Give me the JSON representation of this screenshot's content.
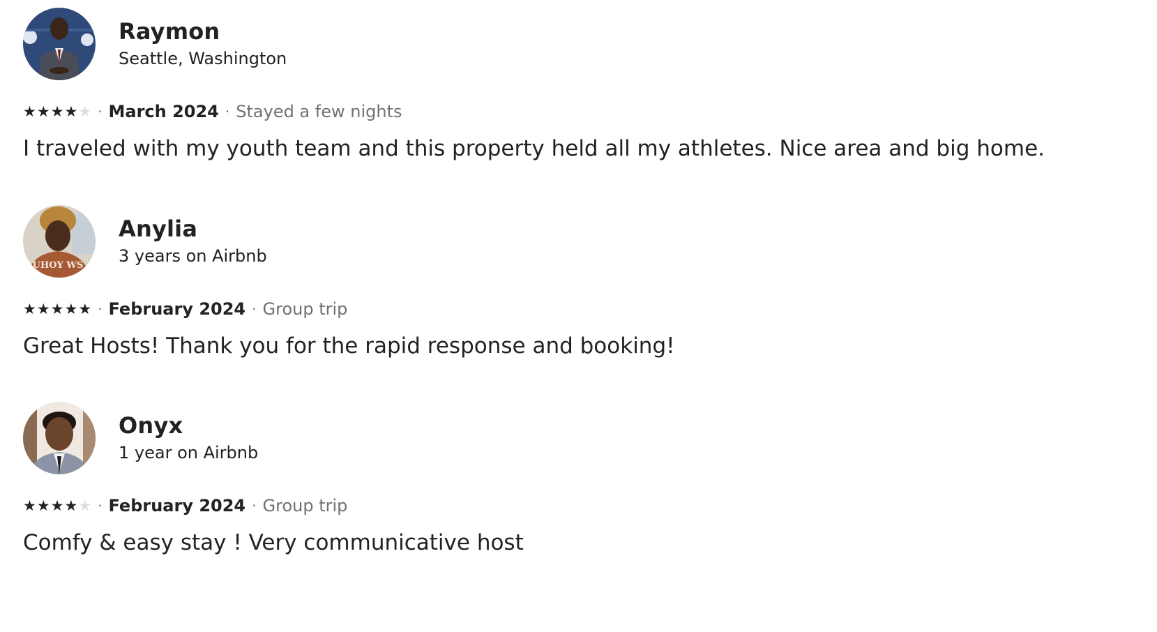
{
  "reviews": [
    {
      "name": "Raymon",
      "meta": "Seattle, Washington",
      "rating": 4,
      "rating_max": 5,
      "date": "March 2024",
      "trip_type": "Stayed a few nights",
      "text": "I traveled with my youth team and this property held all my athletes. Nice area and big home.",
      "avatar_icon": "avatar-photo"
    },
    {
      "name": "Anylia",
      "meta": "3 years on Airbnb",
      "rating": 5,
      "rating_max": 5,
      "date": "February 2024",
      "trip_type": "Group trip",
      "text": "Great Hosts! Thank you for the rapid response and booking!",
      "avatar_icon": "avatar-photo",
      "avatar_shirt_text": "UHOY WS"
    },
    {
      "name": "Onyx",
      "meta": "1 year on Airbnb",
      "rating": 4,
      "rating_max": 5,
      "date": "February 2024",
      "trip_type": "Group trip",
      "text": "Comfy & easy stay ! Very communicative host",
      "avatar_icon": "avatar-photo"
    }
  ],
  "separator": "·",
  "colors": {
    "text": "#222222",
    "muted": "#717171",
    "star_on": "#222222",
    "star_off": "#dddddd"
  }
}
